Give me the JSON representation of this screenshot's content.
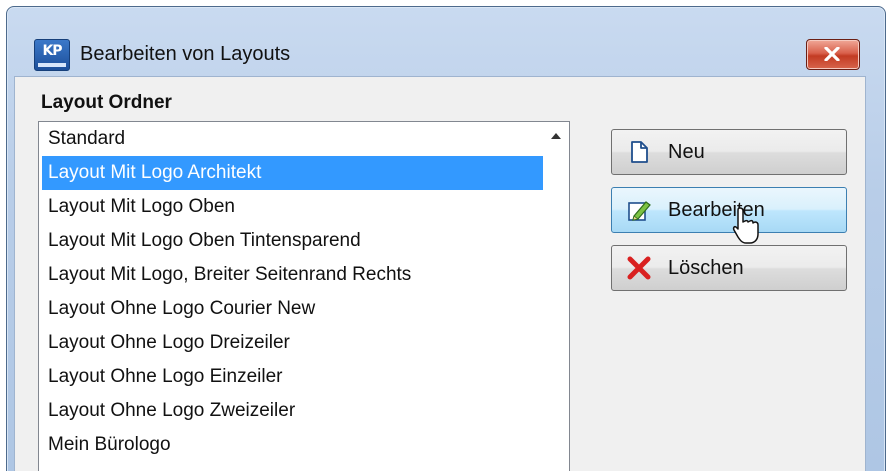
{
  "window": {
    "title": "Bearbeiten von Layouts",
    "icon_text": "KP",
    "icon": "app-icon",
    "close_icon": "close-icon"
  },
  "group": {
    "label": "Layout Ordner"
  },
  "list": {
    "items": [
      "Standard",
      "Layout Mit Logo Architekt",
      "Layout Mit Logo Oben",
      "Layout Mit Logo Oben Tintensparend",
      "Layout Mit Logo, Breiter Seitenrand Rechts",
      "Layout Ohne Logo Courier New",
      "Layout Ohne Logo Dreizeiler",
      "Layout Ohne Logo Einzeiler",
      "Layout Ohne Logo Zweizeiler",
      "Mein Bürologo"
    ],
    "selected": "Layout Mit Logo Architekt"
  },
  "buttons": {
    "new_label": "Neu",
    "edit_label": "Bearbeiten",
    "delete_label": "Löschen"
  },
  "icons": {
    "new": "new-document-icon",
    "edit": "edit-pencil-icon",
    "delete": "delete-x-icon",
    "cursor": "mouse-cursor-icon"
  },
  "colors": {
    "selection": "#3399ff",
    "close_button": "#c23b23",
    "button_hover": "#bee6fd"
  }
}
